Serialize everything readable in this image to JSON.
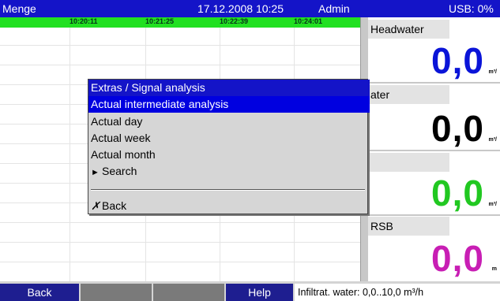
{
  "header": {
    "channel_name": "Menge",
    "datetime": "17.12.2008 10:25",
    "user": "Admin",
    "usb_status": "USB: 0%"
  },
  "timeline": {
    "times": [
      "10:20:11",
      "10:21:25",
      "10:22:39",
      "10:24:01"
    ]
  },
  "channels": [
    {
      "label": "Headwater",
      "value": "0,0",
      "unit": "m³/",
      "color": "#0a14d8"
    },
    {
      "label": "ater",
      "value": "0,0",
      "unit": "m³/",
      "color": "#000000"
    },
    {
      "label": "",
      "value": "0,0",
      "unit": "m³/",
      "color": "#21c821"
    },
    {
      "label": "RSB",
      "value": "0,0",
      "unit": "m",
      "color": "#c81eb4"
    }
  ],
  "menu": {
    "title": "Extras / Signal analysis",
    "items": [
      {
        "label": "Actual intermediate analysis",
        "selected": true
      },
      {
        "label": "Actual day"
      },
      {
        "label": "Actual week"
      },
      {
        "label": "Actual month"
      },
      {
        "label": "Search",
        "icon": "submenu-arrow-icon",
        "glyph": "►"
      }
    ],
    "back": {
      "label": "Back",
      "icon": "cross-icon",
      "glyph": "✗"
    }
  },
  "softkeys": {
    "back": "Back",
    "key2": "",
    "key3": "",
    "help": "Help"
  },
  "status_text": "Infiltrat. water: 0,0..10,0 m³/h",
  "colors": {
    "header_bg": "#1414c8",
    "timeline_bg": "#21e021",
    "menu_bg": "#d6d6d6",
    "menu_selected": "#0000e0",
    "softkey_bg": "#1e1e90"
  }
}
